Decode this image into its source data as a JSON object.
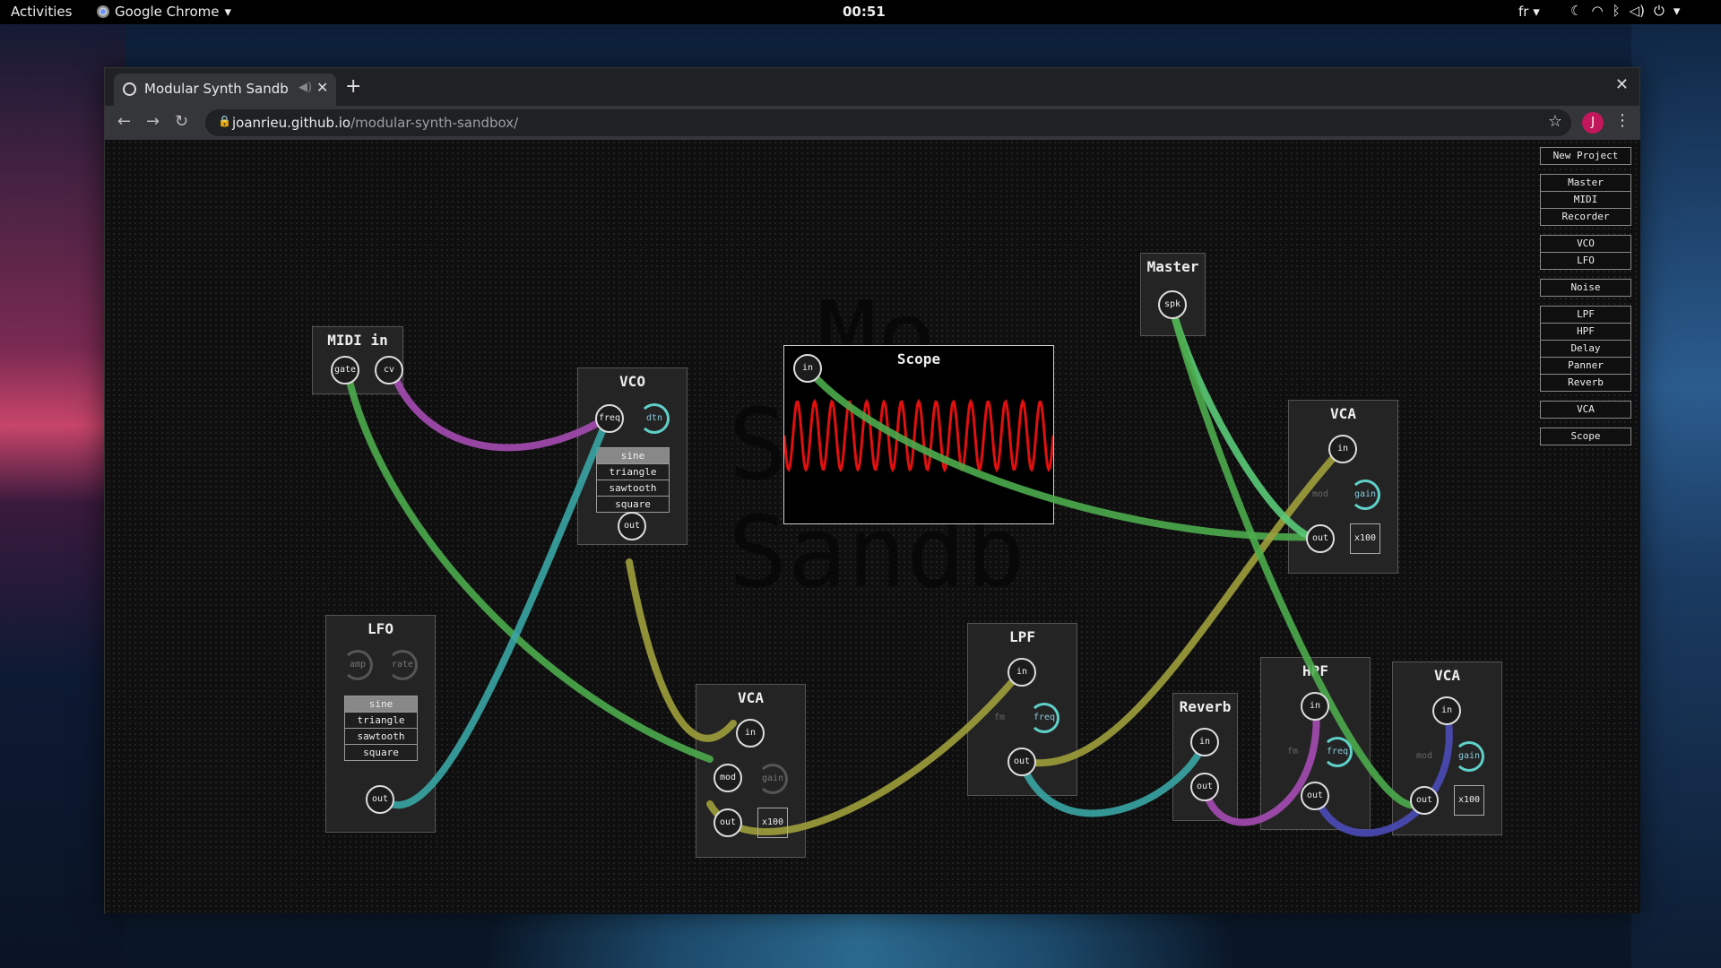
{
  "topbar": {
    "activities": "Activities",
    "app": "Google Chrome",
    "clock": "00:51",
    "lang": "fr"
  },
  "browser": {
    "tab_title": "Modular Synth Sandbox",
    "url_host": "joanrieu.github.io",
    "url_path": "/modular-synth-sandbox/",
    "avatar": "J"
  },
  "watermark": [
    "Mo",
    "Synth",
    "Sandb"
  ],
  "sidebar": {
    "new_project": "New Project",
    "io": [
      "Master",
      "MIDI",
      "Recorder"
    ],
    "sources": [
      "VCO",
      "LFO"
    ],
    "noise": "Noise",
    "effects": [
      "LPF",
      "HPF",
      "Delay",
      "Panner",
      "Reverb"
    ],
    "vca": "VCA",
    "scope": "Scope"
  },
  "waveforms": [
    "sine",
    "triangle",
    "sawtooth",
    "square"
  ],
  "modules": {
    "midi": {
      "title": "MIDI in",
      "gate": "gate",
      "cv": "cv"
    },
    "vco": {
      "title": "VCO",
      "freq": "freq",
      "dtn": "dtn",
      "selected": "sine",
      "out": "out"
    },
    "lfo": {
      "title": "LFO",
      "amp": "amp",
      "rate": "rate",
      "selected": "sine",
      "out": "out"
    },
    "scope": {
      "title": "Scope",
      "in": "in"
    },
    "master": {
      "title": "Master",
      "spk": "spk"
    },
    "vca1": {
      "title": "VCA",
      "in": "in",
      "mod": "mod",
      "gain": "gain",
      "out": "out",
      "mult": "x100"
    },
    "vca2": {
      "title": "VCA",
      "in": "in",
      "mod": "mod",
      "gain": "gain",
      "out": "out",
      "mult": "x100"
    },
    "vca3": {
      "title": "VCA",
      "in": "in",
      "mod": "mod",
      "gain": "gain",
      "out": "out",
      "mult": "x100"
    },
    "lpf": {
      "title": "LPF",
      "in": "in",
      "fm": "fm",
      "freq": "freq",
      "out": "out"
    },
    "reverb": {
      "title": "Reverb",
      "in": "in",
      "out": "out"
    },
    "hpf": {
      "title": "HPF",
      "in": "in",
      "fm": "fm",
      "freq": "freq",
      "out": "out"
    }
  },
  "colors": {
    "green": "#4cab4c",
    "purple": "#a54cb3",
    "teal": "#3aa5a5",
    "olive": "#9e9e3c",
    "blue": "#4b4bb8",
    "light_green": "#5acb78",
    "scope_wave": "#e01010"
  }
}
